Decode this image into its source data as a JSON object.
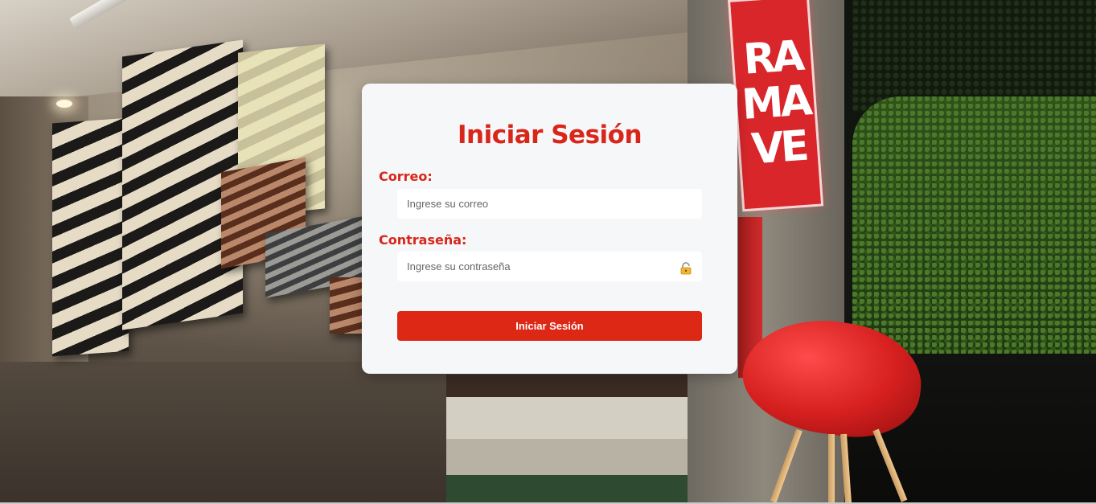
{
  "login": {
    "title": "Iniciar Sesión",
    "email_label": "Correo:",
    "email_placeholder": "Ingrese su correo",
    "email_value": "",
    "password_label": "Contraseña:",
    "password_placeholder": "Ingrese su contraseña",
    "password_value": "",
    "password_icon": "lock-icon",
    "submit_label": "Iniciar Sesión"
  },
  "background": {
    "sign_text": "RAMAVE"
  },
  "colors": {
    "accent": "#dc2814",
    "title": "#d9261a",
    "card": "#f6f7f9"
  }
}
